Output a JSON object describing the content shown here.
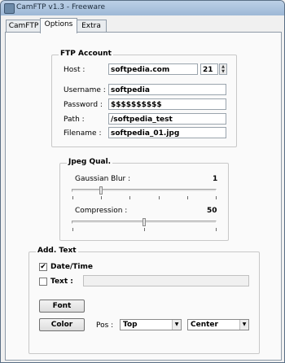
{
  "window": {
    "title": "CamFTP v1.3 - Freeware"
  },
  "tabs": [
    {
      "label": "CamFTP"
    },
    {
      "label": "Options",
      "active": true
    },
    {
      "label": "Extra"
    }
  ],
  "ftp": {
    "title": "FTP Account",
    "host_label": "Host :",
    "host_value": "softpedia.com",
    "port_value": "21",
    "username_label": "Username :",
    "username_value": "softpedia",
    "password_label": "Password :",
    "password_value": "$$$$$$$$$$",
    "path_label": "Path :",
    "path_value": "/softpedia_test",
    "filename_label": "Filename :",
    "filename_value": "softpedia_01.jpg"
  },
  "jpeg": {
    "title": "Jpeg Qual.",
    "blur_label": "Gaussian Blur :",
    "blur_value": "1",
    "compression_label": "Compression :",
    "compression_value": "50"
  },
  "addtext": {
    "title": "Add. Text",
    "datetime_label": "Date/Time",
    "datetime_checked": true,
    "text_label": "Text :",
    "text_checked": false,
    "text_value": "",
    "font_button": "Font",
    "color_button": "Color",
    "pos_label": "Pos :",
    "pos_vertical": "Top",
    "pos_horizontal": "Center"
  }
}
